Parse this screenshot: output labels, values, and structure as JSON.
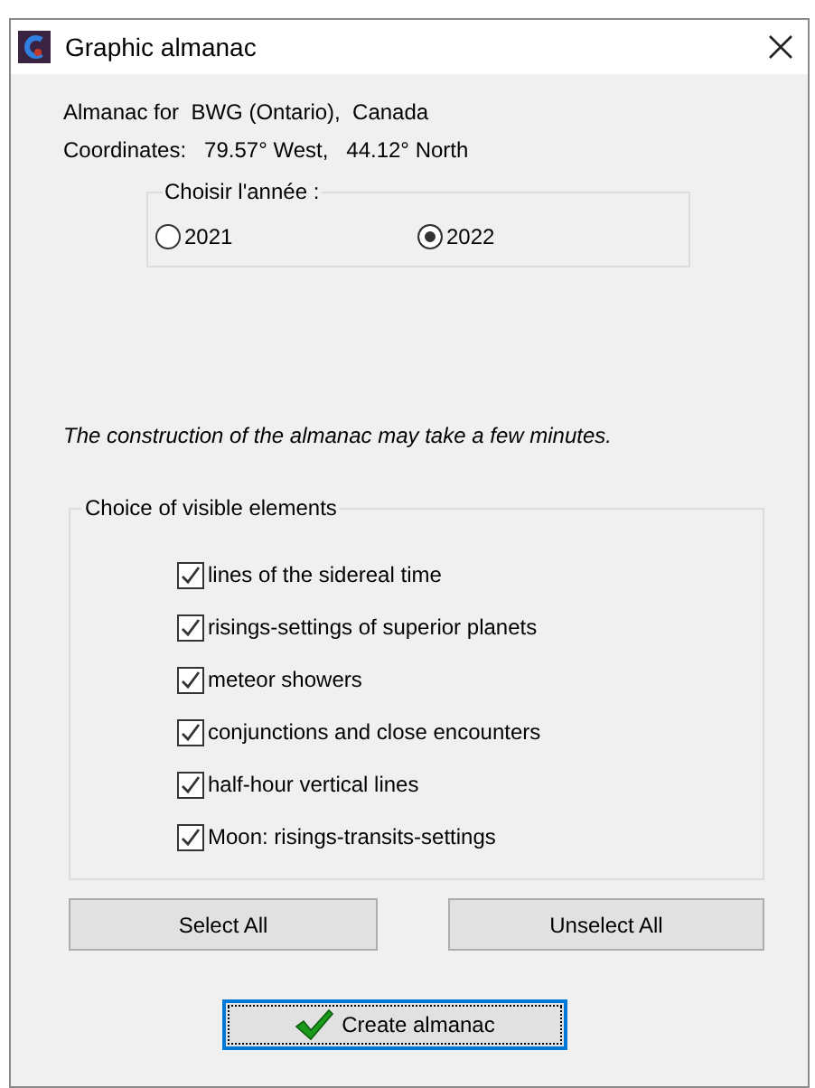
{
  "window": {
    "title": "Graphic almanac"
  },
  "info": [
    "Almanac for  BWG (Ontario),  Canada",
    "Coordinates:   79.57° West,   44.12° North"
  ],
  "year_group": {
    "legend": "Choisir l'année :",
    "options": [
      {
        "label": "2021",
        "selected": false
      },
      {
        "label": "2022",
        "selected": true
      }
    ]
  },
  "notice": "The construction of the almanac may take a few minutes.",
  "elements_group": {
    "legend": "Choice of visible elements",
    "items": [
      {
        "label": "lines of the sidereal time",
        "checked": true
      },
      {
        "label": "risings-settings of superior planets",
        "checked": true
      },
      {
        "label": "meteor showers",
        "checked": true
      },
      {
        "label": "conjunctions and close encounters",
        "checked": true
      },
      {
        "label": "half-hour vertical lines",
        "checked": true
      },
      {
        "label": "Moon: risings-transits-settings",
        "checked": true
      }
    ]
  },
  "buttons": [
    "Select All",
    "Unselect All"
  ],
  "primary_button": "Create almanac"
}
